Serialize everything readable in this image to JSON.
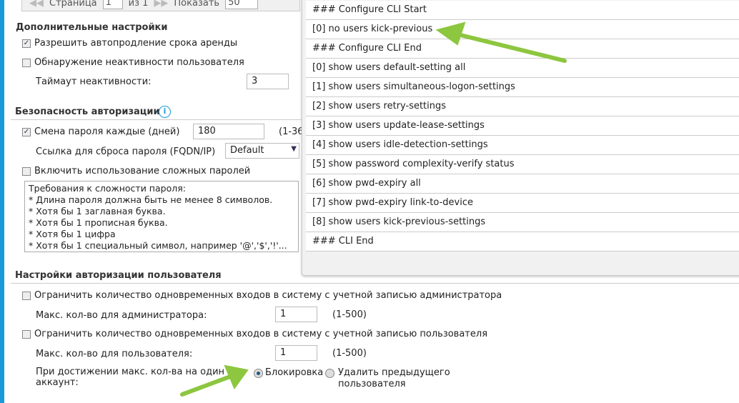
{
  "pager": {
    "page_label": "Страница",
    "page_value": "1",
    "of_label": "из 1",
    "show_label": "Показать",
    "show_value": "50"
  },
  "additional": {
    "title": "Дополнительные настройки",
    "auto_renew": {
      "label": "Разрешить автопродление срока аренды",
      "checked": true
    },
    "idle_detect": {
      "label": "Обнаружение неактивности пользователя",
      "checked": false
    },
    "idle_timeout_label": "Таймаут неактивности:",
    "idle_timeout_value": "3"
  },
  "security": {
    "title": "Безопасность авторизации",
    "info_icon": "info-icon",
    "pw_change": {
      "label": "Смена пароля каждые (дней)",
      "checked": true,
      "value": "180",
      "range": "(1-36"
    },
    "reset_link_label": "Ссылка для сброса пароля (FQDN/IP)",
    "reset_link_value": "Default",
    "complex": {
      "label": "Включить использование сложных паролей",
      "checked": false
    },
    "requirements": [
      "Требования к сложности пароля:",
      "* Длина пароля должна быть не менее 8 символов.",
      "* Хотя бы 1 заглавная буква.",
      "* Хотя бы 1 прописная буква.",
      "* Хотя бы 1 цифра",
      "* Хотя бы 1 специальный символ, например '@','$','!'..."
    ]
  },
  "auth": {
    "title": "Настройки авторизации пользователя",
    "admin_limit": {
      "label": "Ограничить количество одновременных входов в систему с учетной записью администратора",
      "checked": false
    },
    "admin_max_label": "Макс. кол-во для администратора:",
    "admin_max_value": "1",
    "admin_range": "(1-500)",
    "user_limit": {
      "label": "Ограничить количество одновременных входов в систему с учетной записью пользователя",
      "checked": false
    },
    "user_max_label": "Макс. кол-во для пользователя:",
    "user_max_value": "1",
    "user_range": "(1-500)",
    "on_max_label_1": "При достижении макс. кол-ва на один",
    "on_max_label_2": "аккаунт:",
    "option_block": "Блокировка",
    "option_remove_1": "Удалить предыдущего",
    "option_remove_2": "пользователя",
    "selected": "Блокировка"
  },
  "cli": [
    "### Configure CLI Start",
    "[0] no users kick-previous",
    "### Configure CLI End",
    "[0] show users default-setting all",
    "[1] show users simultaneous-logon-settings",
    "[2] show users retry-settings",
    "[3] show users update-lease-settings",
    "[4] show users idle-detection-settings",
    "[5] show password complexity-verify status",
    "[6] show pwd-expiry all",
    "[7] show pwd-expiry link-to-device",
    "[8] show users kick-previous-settings",
    "### CLI End"
  ],
  "colors": {
    "accent": "#1a9ad6",
    "arrow": "#8dc63f"
  }
}
